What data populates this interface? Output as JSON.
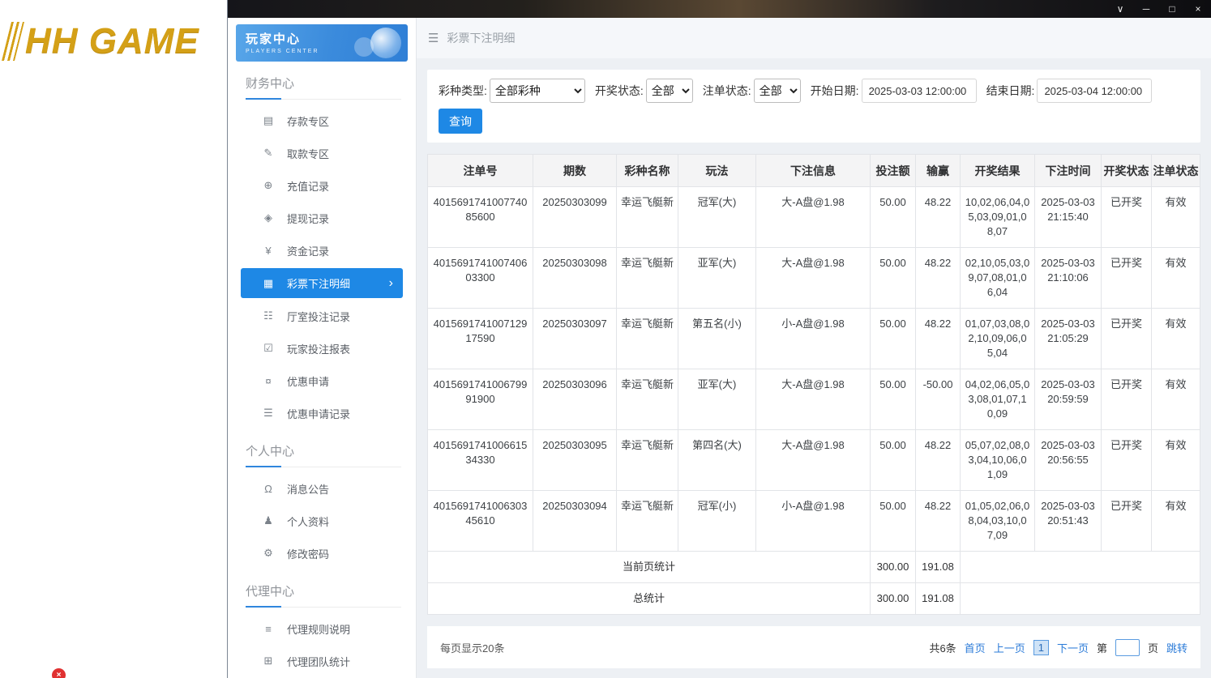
{
  "titlebar": {
    "chevron": "∨",
    "minimize": "─",
    "maximize": "□",
    "close": "×"
  },
  "left_panel": {
    "logo_text": "HH GAME",
    "error_badge": "×"
  },
  "sidebar": {
    "title": "玩家中心",
    "subtitle": "PLAYERS CENTER",
    "active_arrow_glyph": "›",
    "sections": [
      {
        "title": "财务中心",
        "items": [
          {
            "label": "存款专区",
            "icon": "deposit-icon",
            "glyph": "▤"
          },
          {
            "label": "取款专区",
            "icon": "withdraw-icon",
            "glyph": "✎"
          },
          {
            "label": "充值记录",
            "icon": "recharge-record-icon",
            "glyph": "⊕"
          },
          {
            "label": "提现记录",
            "icon": "withdrawal-record-icon",
            "glyph": "◈"
          },
          {
            "label": "资金记录",
            "icon": "funds-record-icon",
            "glyph": "¥"
          },
          {
            "label": "彩票下注明细",
            "icon": "lottery-bet-detail-icon",
            "glyph": "▦",
            "active": true
          },
          {
            "label": "厅室投注记录",
            "icon": "hall-bet-record-icon",
            "glyph": "☷"
          },
          {
            "label": "玩家投注报表",
            "icon": "player-bet-report-icon",
            "glyph": "☑"
          },
          {
            "label": "优惠申请",
            "icon": "promo-apply-icon",
            "glyph": "¤"
          },
          {
            "label": "优惠申请记录",
            "icon": "promo-record-icon",
            "glyph": "☰"
          }
        ]
      },
      {
        "title": "个人中心",
        "items": [
          {
            "label": "消息公告",
            "icon": "bell-icon",
            "glyph": "Ω"
          },
          {
            "label": "个人资料",
            "icon": "user-icon",
            "glyph": "♟"
          },
          {
            "label": "修改密码",
            "icon": "gear-icon",
            "glyph": "⚙"
          }
        ]
      },
      {
        "title": "代理中心",
        "items": [
          {
            "label": "代理规则说明",
            "icon": "document-icon",
            "glyph": "≡"
          },
          {
            "label": "代理团队统计",
            "icon": "team-stats-icon",
            "glyph": "⊞"
          }
        ]
      }
    ]
  },
  "main": {
    "menu_icon_glyph": "☰",
    "page_title": "彩票下注明细",
    "filters": {
      "lottery_type_label": "彩种类型:",
      "lottery_type_value": "全部彩种",
      "draw_status_label": "开奖状态:",
      "draw_status_value": "全部",
      "bet_status_label": "注单状态:",
      "bet_status_value": "全部",
      "start_date_label": "开始日期:",
      "start_date_value": "2025-03-03 12:00:00",
      "end_date_label": "结束日期:",
      "end_date_value": "2025-03-04 12:00:00",
      "query_button_label": "查询"
    },
    "table": {
      "columns": [
        "注单号",
        "期数",
        "彩种名称",
        "玩法",
        "下注信息",
        "投注额",
        "输赢",
        "开奖结果",
        "下注时间",
        "开奖状态",
        "注单状态"
      ],
      "rows": [
        [
          "401569174100774085600",
          "20250303099",
          "幸运飞艇新",
          "冠军(大)",
          "大-A盘@1.98",
          "50.00",
          "48.22",
          "10,02,06,04,05,03,09,01,08,07",
          "2025-03-03 21:15:40",
          "已开奖",
          "有效"
        ],
        [
          "401569174100740603300",
          "20250303098",
          "幸运飞艇新",
          "亚军(大)",
          "大-A盘@1.98",
          "50.00",
          "48.22",
          "02,10,05,03,09,07,08,01,06,04",
          "2025-03-03 21:10:06",
          "已开奖",
          "有效"
        ],
        [
          "401569174100712917590",
          "20250303097",
          "幸运飞艇新",
          "第五名(小)",
          "小-A盘@1.98",
          "50.00",
          "48.22",
          "01,07,03,08,02,10,09,06,05,04",
          "2025-03-03 21:05:29",
          "已开奖",
          "有效"
        ],
        [
          "401569174100679991900",
          "20250303096",
          "幸运飞艇新",
          "亚军(大)",
          "大-A盘@1.98",
          "50.00",
          "-50.00",
          "04,02,06,05,03,08,01,07,10,09",
          "2025-03-03 20:59:59",
          "已开奖",
          "有效"
        ],
        [
          "401569174100661534330",
          "20250303095",
          "幸运飞艇新",
          "第四名(大)",
          "大-A盘@1.98",
          "50.00",
          "48.22",
          "05,07,02,08,03,04,10,06,01,09",
          "2025-03-03 20:56:55",
          "已开奖",
          "有效"
        ],
        [
          "401569174100630345610",
          "20250303094",
          "幸运飞艇新",
          "冠军(小)",
          "小-A盘@1.98",
          "50.00",
          "48.22",
          "01,05,02,06,08,04,03,10,07,09",
          "2025-03-03 20:51:43",
          "已开奖",
          "有效"
        ]
      ],
      "summary_rows": [
        {
          "label": "当前页统计",
          "bet_total": "300.00",
          "winloss_total": "191.08"
        },
        {
          "label": "总统计",
          "bet_total": "300.00",
          "winloss_total": "191.08"
        }
      ]
    },
    "pagination": {
      "per_page_text": "每页显示20条",
      "total_text": "共6条",
      "first_label": "首页",
      "prev_label": "上一页",
      "current_page": "1",
      "next_label": "下一页",
      "page_prefix": "第",
      "page_suffix": "页",
      "jump_label": "跳转",
      "jump_value": ""
    }
  },
  "colors": {
    "accent_blue": "#1e88e5",
    "link_blue": "#2b7bd8",
    "logo_gold": "#d4a017"
  }
}
